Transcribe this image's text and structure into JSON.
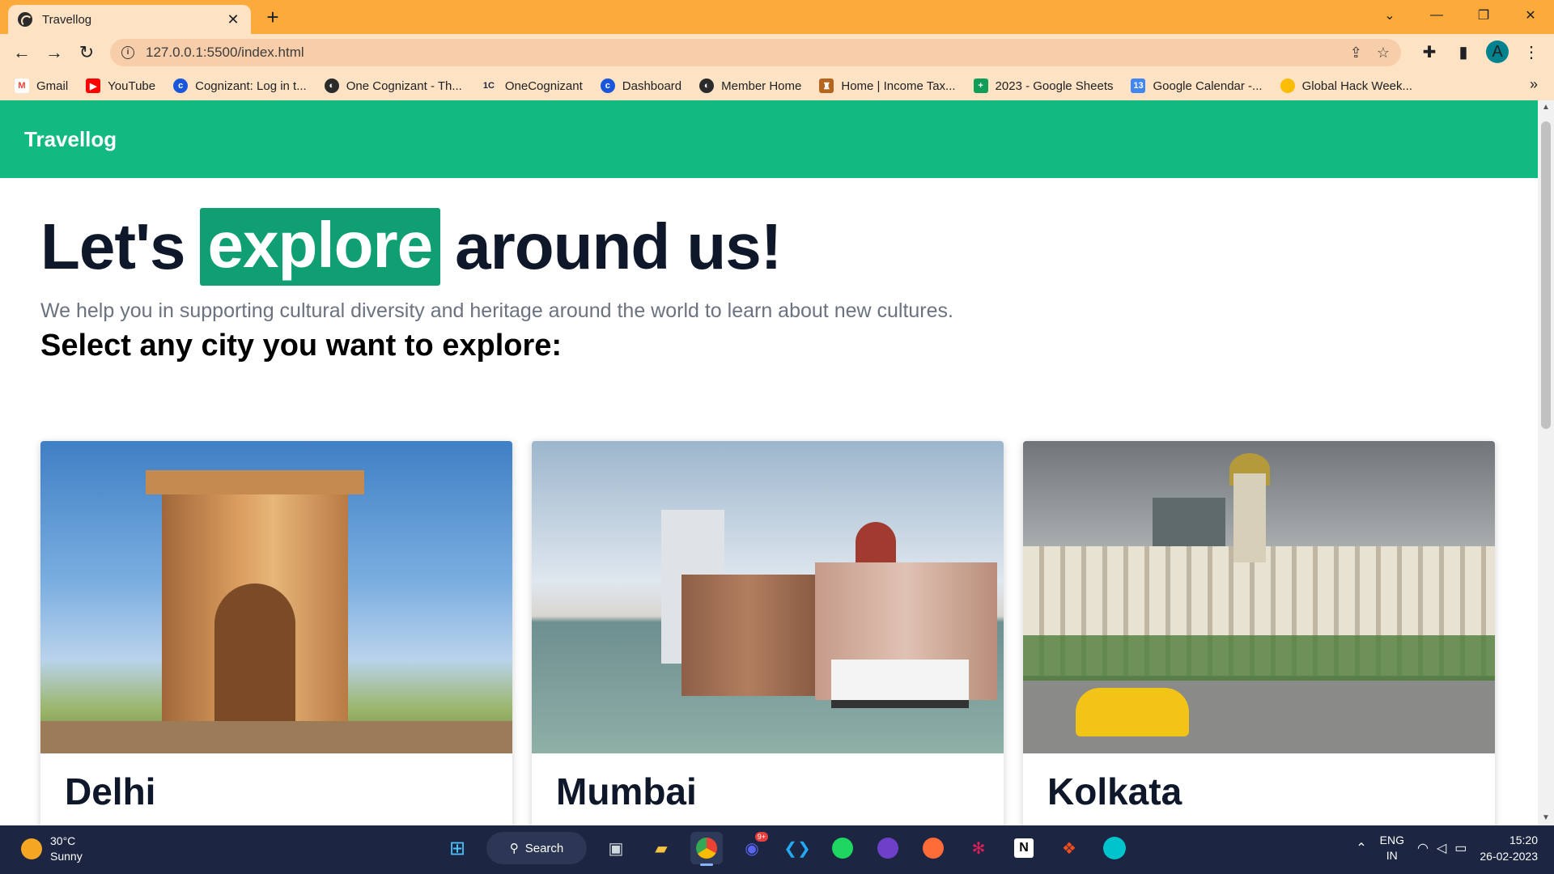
{
  "browser": {
    "tab_title": "Travellog",
    "url": "127.0.0.1:5500/index.html",
    "bookmarks": [
      {
        "label": "Gmail",
        "icon": "gmail-icon",
        "color": "#ea4335"
      },
      {
        "label": "YouTube",
        "icon": "youtube-icon",
        "color": "#ff0000"
      },
      {
        "label": "Cognizant: Log in t...",
        "icon": "cognizant-icon",
        "color": "#1a56db"
      },
      {
        "label": "One Cognizant - Th...",
        "icon": "globe-icon",
        "color": "#2b2b2b"
      },
      {
        "label": "OneCognizant",
        "icon": "onecognizant-icon",
        "color": "#1c2541"
      },
      {
        "label": "Dashboard",
        "icon": "cognizant-icon",
        "color": "#1a56db"
      },
      {
        "label": "Member Home",
        "icon": "globe-icon",
        "color": "#2b2b2b"
      },
      {
        "label": "Home | Income Tax...",
        "icon": "incometax-icon",
        "color": "#b5651d"
      },
      {
        "label": "2023 - Google Sheets",
        "icon": "sheets-icon",
        "color": "#0f9d58"
      },
      {
        "label": "Google Calendar -...",
        "icon": "calendar-icon",
        "color": "#4285f4"
      },
      {
        "label": "Global Hack Week...",
        "icon": "bulb-icon",
        "color": "#fbbc04"
      }
    ]
  },
  "site": {
    "brand": "Travellog",
    "hero_prefix": "Let's",
    "hero_highlight": "explore",
    "hero_suffix": "around us!",
    "subtitle": "We help you in supporting cultural diversity and heritage around the world to learn about new cultures.",
    "section_title": "Select any city you want to explore:",
    "cities": [
      {
        "name": "Delhi"
      },
      {
        "name": "Mumbai"
      },
      {
        "name": "Kolkata"
      }
    ],
    "colors": {
      "nav": "#12b981",
      "highlight": "#0f9f73"
    }
  },
  "taskbar": {
    "temperature": "30°C",
    "weather": "Sunny",
    "search_label": "Search",
    "lang_top": "ENG",
    "lang_bottom": "IN",
    "time": "15:20",
    "date": "26-02-2023",
    "discord_badge": "9+"
  }
}
